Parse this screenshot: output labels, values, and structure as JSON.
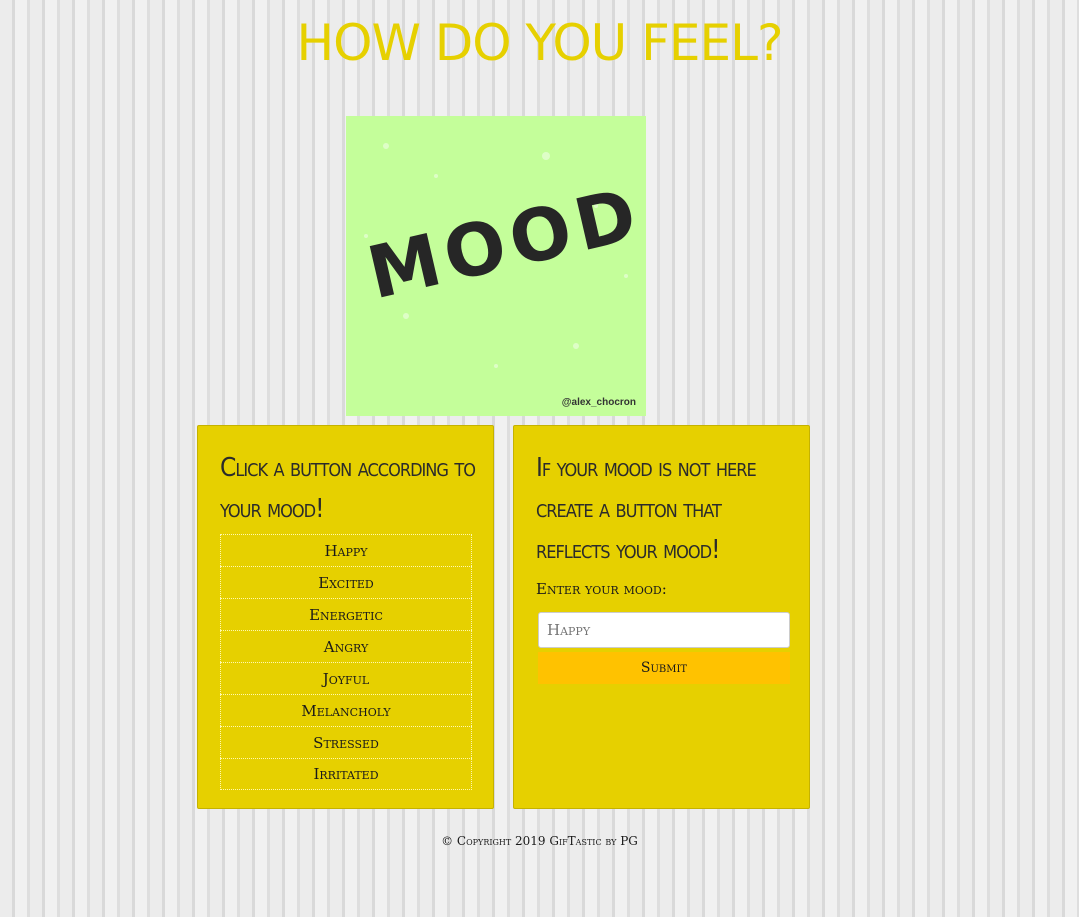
{
  "page": {
    "title": "HOW DO YOU FEEL?"
  },
  "image": {
    "word": "MOOD",
    "credit": "@alex_chocron"
  },
  "left_panel": {
    "heading": "Click a button according to your mood!",
    "buttons": [
      "Happy",
      "Excited",
      "Energetic",
      "Angry",
      "Joyful",
      "Melancholy",
      "Stressed",
      "Irritated"
    ]
  },
  "right_panel": {
    "heading": "If your mood is not here create a button that reflects your mood!",
    "input_label": "Enter your mood:",
    "input_placeholder": "Happy",
    "submit_label": "Submit"
  },
  "footer": {
    "text": "© Copyright 2019 GifTastic by PG"
  },
  "colors": {
    "title": "#e6d000",
    "panel": "#e6d000",
    "submit": "#ffc200",
    "image_bg": "#c4fe9a"
  }
}
